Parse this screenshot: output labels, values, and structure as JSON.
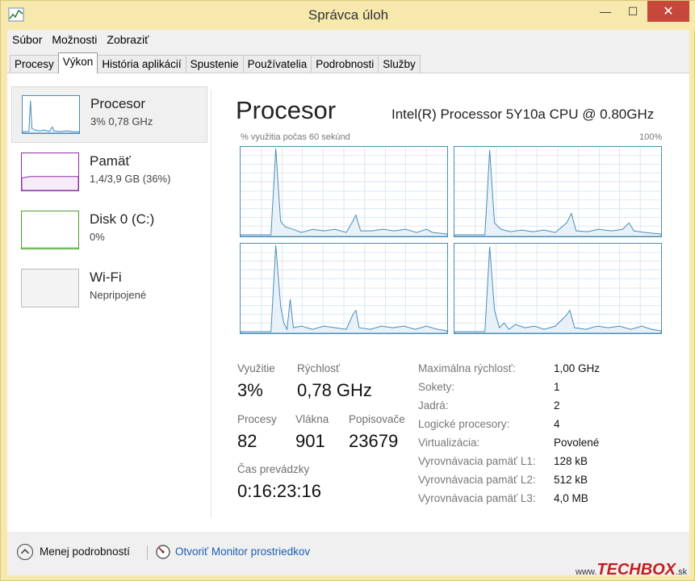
{
  "window": {
    "title": "Správca úloh",
    "controls": {
      "minimize": "—",
      "maximize": "☐",
      "close": "✕"
    }
  },
  "menu": [
    "Súbor",
    "Možnosti",
    "Zobraziť"
  ],
  "tabs": [
    {
      "label": "Procesy",
      "active": false
    },
    {
      "label": "Výkon",
      "active": true
    },
    {
      "label": "História aplikácií",
      "active": false
    },
    {
      "label": "Spustenie",
      "active": false
    },
    {
      "label": "Používatelia",
      "active": false
    },
    {
      "label": "Podrobnosti",
      "active": false
    },
    {
      "label": "Služby",
      "active": false
    }
  ],
  "sidebar": {
    "items": [
      {
        "title": "Procesor",
        "subtitle": "3%  0,78 GHz",
        "color": "#4a8cb8",
        "selected": true
      },
      {
        "title": "Pamäť",
        "subtitle": "1,4/3,9 GB (36%)",
        "color": "#8b2fa0",
        "selected": false
      },
      {
        "title": "Disk 0 (C:)",
        "subtitle": "0%",
        "color": "#4aa02c",
        "selected": false
      },
      {
        "title": "Wi-Fi",
        "subtitle": "Nepripojené",
        "color": "#aaaaaa",
        "selected": false
      }
    ]
  },
  "main": {
    "title": "Procesor",
    "cpu_name": "Intel(R) Processor 5Y10a CPU @ 0.80GHz",
    "graph_caption_left": "% využitia počas 60 sekúnd",
    "graph_caption_right": "100%",
    "stats": {
      "utilization_label": "Využitie",
      "utilization_value": "3%",
      "speed_label": "Rýchlosť",
      "speed_value": "0,78 GHz",
      "processes_label": "Procesy",
      "processes_value": "82",
      "threads_label": "Vlákna",
      "threads_value": "901",
      "handles_label": "Popisovače",
      "handles_value": "23679",
      "uptime_label": "Čas prevádzky",
      "uptime_value": "0:16:23:16"
    },
    "details": [
      {
        "label": "Maximálna rýchlosť:",
        "value": "1,00 GHz"
      },
      {
        "label": "Sokety:",
        "value": "1"
      },
      {
        "label": "Jadrá:",
        "value": "2"
      },
      {
        "label": "Logické procesory:",
        "value": "4"
      },
      {
        "label": "Virtualizácia:",
        "value": "Povolené"
      },
      {
        "label": "Vyrovnávacia pamäť L1:",
        "value": "128 kB"
      },
      {
        "label": "Vyrovnávacia pamäť L2:",
        "value": "512 kB"
      },
      {
        "label": "Vyrovnávacia pamäť L3:",
        "value": "4,0 MB"
      }
    ]
  },
  "footer": {
    "fewer_details": "Menej podrobností",
    "open_monitor": "Otvoriť Monitor prostriedkov"
  },
  "watermark": {
    "prefix": "www.",
    "tech": "TECH",
    "box": "BOX",
    "suffix": ".sk"
  },
  "colors": {
    "cpu": "#4a8cb8",
    "cpu_fill": "#e8f1f8",
    "accent_bar": "#f7e8ae",
    "close_button": "#c7473a",
    "link": "#1a5fb4"
  },
  "icons": {
    "app": "task-manager-icon",
    "fewer": "chevron-up-icon",
    "monitor": "resource-monitor-icon"
  }
}
